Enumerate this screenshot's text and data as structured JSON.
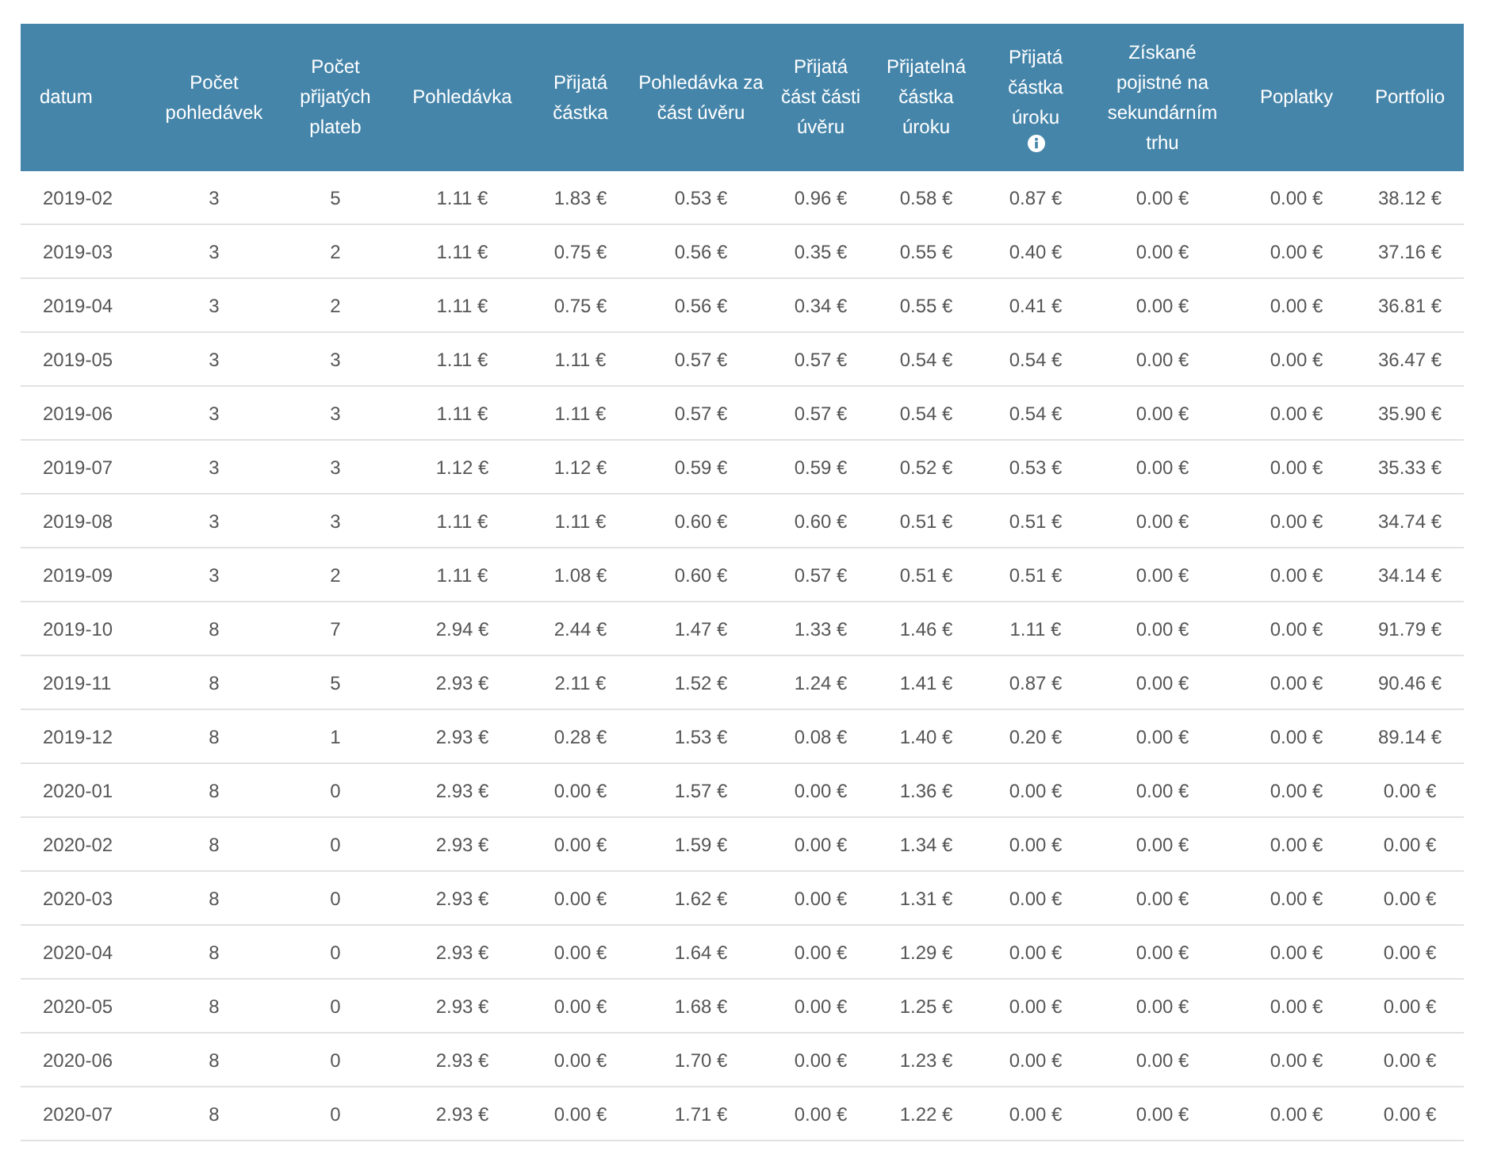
{
  "table": {
    "columns": [
      {
        "label": "datum",
        "info": false
      },
      {
        "label": "Počet pohledávek",
        "info": false
      },
      {
        "label": "Počet přijatých plateb",
        "info": false
      },
      {
        "label": "Pohledávka",
        "info": false
      },
      {
        "label": "Přijatá částka",
        "info": false
      },
      {
        "label": "Pohledávka za část úvěru",
        "info": false
      },
      {
        "label": "Přijatá část části úvěru",
        "info": false
      },
      {
        "label": "Přijatelná částka úroku",
        "info": false
      },
      {
        "label": "Přijatá částka úroku",
        "info": true
      },
      {
        "label": "Získané pojistné na sekundárním trhu",
        "info": false
      },
      {
        "label": "Poplatky",
        "info": false
      },
      {
        "label": "Portfolio",
        "info": false
      }
    ],
    "rows": [
      [
        "2019-02",
        "3",
        "5",
        "1.11 €",
        "1.83 €",
        "0.53 €",
        "0.96 €",
        "0.58 €",
        "0.87 €",
        "0.00 €",
        "0.00 €",
        "38.12 €"
      ],
      [
        "2019-03",
        "3",
        "2",
        "1.11 €",
        "0.75 €",
        "0.56 €",
        "0.35 €",
        "0.55 €",
        "0.40 €",
        "0.00 €",
        "0.00 €",
        "37.16 €"
      ],
      [
        "2019-04",
        "3",
        "2",
        "1.11 €",
        "0.75 €",
        "0.56 €",
        "0.34 €",
        "0.55 €",
        "0.41 €",
        "0.00 €",
        "0.00 €",
        "36.81 €"
      ],
      [
        "2019-05",
        "3",
        "3",
        "1.11 €",
        "1.11 €",
        "0.57 €",
        "0.57 €",
        "0.54 €",
        "0.54 €",
        "0.00 €",
        "0.00 €",
        "36.47 €"
      ],
      [
        "2019-06",
        "3",
        "3",
        "1.11 €",
        "1.11 €",
        "0.57 €",
        "0.57 €",
        "0.54 €",
        "0.54 €",
        "0.00 €",
        "0.00 €",
        "35.90 €"
      ],
      [
        "2019-07",
        "3",
        "3",
        "1.12 €",
        "1.12 €",
        "0.59 €",
        "0.59 €",
        "0.52 €",
        "0.53 €",
        "0.00 €",
        "0.00 €",
        "35.33 €"
      ],
      [
        "2019-08",
        "3",
        "3",
        "1.11 €",
        "1.11 €",
        "0.60 €",
        "0.60 €",
        "0.51 €",
        "0.51 €",
        "0.00 €",
        "0.00 €",
        "34.74 €"
      ],
      [
        "2019-09",
        "3",
        "2",
        "1.11 €",
        "1.08 €",
        "0.60 €",
        "0.57 €",
        "0.51 €",
        "0.51 €",
        "0.00 €",
        "0.00 €",
        "34.14 €"
      ],
      [
        "2019-10",
        "8",
        "7",
        "2.94 €",
        "2.44 €",
        "1.47 €",
        "1.33 €",
        "1.46 €",
        "1.11 €",
        "0.00 €",
        "0.00 €",
        "91.79 €"
      ],
      [
        "2019-11",
        "8",
        "5",
        "2.93 €",
        "2.11 €",
        "1.52 €",
        "1.24 €",
        "1.41 €",
        "0.87 €",
        "0.00 €",
        "0.00 €",
        "90.46 €"
      ],
      [
        "2019-12",
        "8",
        "1",
        "2.93 €",
        "0.28 €",
        "1.53 €",
        "0.08 €",
        "1.40 €",
        "0.20 €",
        "0.00 €",
        "0.00 €",
        "89.14 €"
      ],
      [
        "2020-01",
        "8",
        "0",
        "2.93 €",
        "0.00 €",
        "1.57 €",
        "0.00 €",
        "1.36 €",
        "0.00 €",
        "0.00 €",
        "0.00 €",
        "0.00 €"
      ],
      [
        "2020-02",
        "8",
        "0",
        "2.93 €",
        "0.00 €",
        "1.59 €",
        "0.00 €",
        "1.34 €",
        "0.00 €",
        "0.00 €",
        "0.00 €",
        "0.00 €"
      ],
      [
        "2020-03",
        "8",
        "0",
        "2.93 €",
        "0.00 €",
        "1.62 €",
        "0.00 €",
        "1.31 €",
        "0.00 €",
        "0.00 €",
        "0.00 €",
        "0.00 €"
      ],
      [
        "2020-04",
        "8",
        "0",
        "2.93 €",
        "0.00 €",
        "1.64 €",
        "0.00 €",
        "1.29 €",
        "0.00 €",
        "0.00 €",
        "0.00 €",
        "0.00 €"
      ],
      [
        "2020-05",
        "8",
        "0",
        "2.93 €",
        "0.00 €",
        "1.68 €",
        "0.00 €",
        "1.25 €",
        "0.00 €",
        "0.00 €",
        "0.00 €",
        "0.00 €"
      ],
      [
        "2020-06",
        "8",
        "0",
        "2.93 €",
        "0.00 €",
        "1.70 €",
        "0.00 €",
        "1.23 €",
        "0.00 €",
        "0.00 €",
        "0.00 €",
        "0.00 €"
      ],
      [
        "2020-07",
        "8",
        "0",
        "2.93 €",
        "0.00 €",
        "1.71 €",
        "0.00 €",
        "1.22 €",
        "0.00 €",
        "0.00 €",
        "0.00 €",
        "0.00 €"
      ]
    ]
  }
}
